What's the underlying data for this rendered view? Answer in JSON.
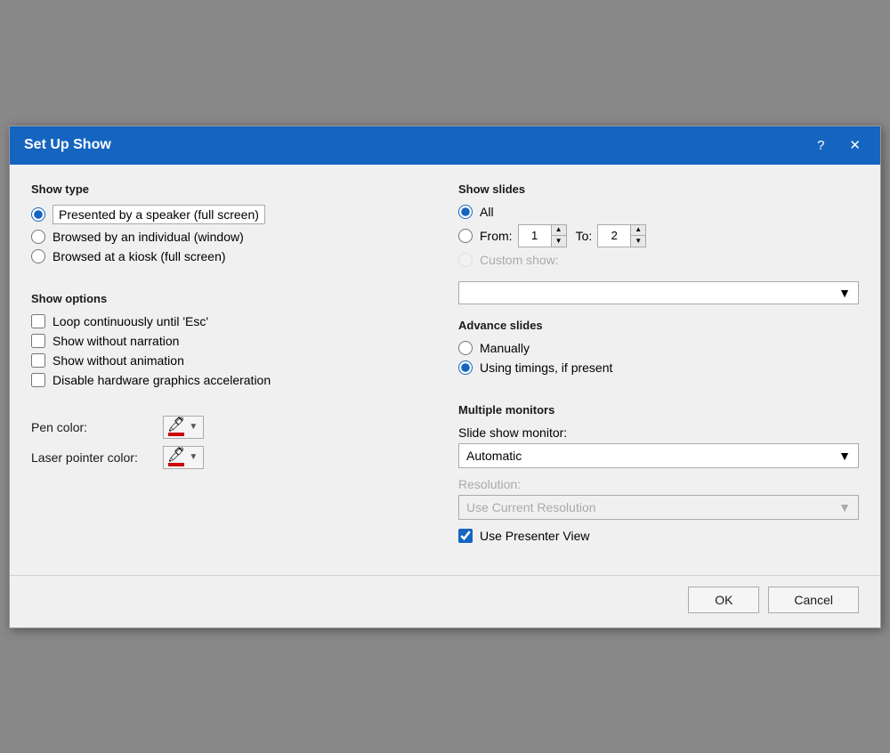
{
  "dialog": {
    "title": "Set Up Show",
    "help_btn": "?",
    "close_btn": "✕"
  },
  "show_type": {
    "label": "Show type",
    "options": [
      {
        "id": "full_screen",
        "label": "Presented by a speaker (full screen)",
        "checked": true
      },
      {
        "id": "window",
        "label": "Browsed by an individual (window)",
        "checked": false
      },
      {
        "id": "kiosk",
        "label": "Browsed at a kiosk (full screen)",
        "checked": false
      }
    ]
  },
  "show_options": {
    "label": "Show options",
    "options": [
      {
        "id": "loop",
        "label": "Loop continuously until 'Esc'",
        "checked": false
      },
      {
        "id": "no_narration",
        "label": "Show without narration",
        "checked": false
      },
      {
        "id": "no_animation",
        "label": "Show without animation",
        "checked": false
      },
      {
        "id": "no_hw_accel",
        "label": "Disable hardware graphics acceleration",
        "checked": false
      }
    ]
  },
  "pen_color": {
    "label": "Pen color:"
  },
  "laser_color": {
    "label": "Laser pointer color:"
  },
  "show_slides": {
    "label": "Show slides",
    "options": [
      {
        "id": "all",
        "label": "All",
        "checked": true
      },
      {
        "id": "from",
        "label": "From:",
        "checked": false
      }
    ],
    "from_value": "1",
    "to_label": "To:",
    "to_value": "2",
    "custom_show_label": "Custom show:",
    "custom_show_disabled": true
  },
  "advance_slides": {
    "label": "Advance slides",
    "options": [
      {
        "id": "manually",
        "label": "Manually",
        "checked": false
      },
      {
        "id": "timings",
        "label": "Using timings, if present",
        "checked": true
      }
    ]
  },
  "multiple_monitors": {
    "label": "Multiple monitors",
    "slide_show_monitor_label": "Slide show monitor:",
    "slide_show_monitor_value": "Automatic",
    "resolution_label": "Resolution:",
    "resolution_value": "Use Current Resolution",
    "use_presenter_view_label": "Use Presenter View",
    "use_presenter_view_checked": true
  },
  "footer": {
    "ok_label": "OK",
    "cancel_label": "Cancel"
  }
}
